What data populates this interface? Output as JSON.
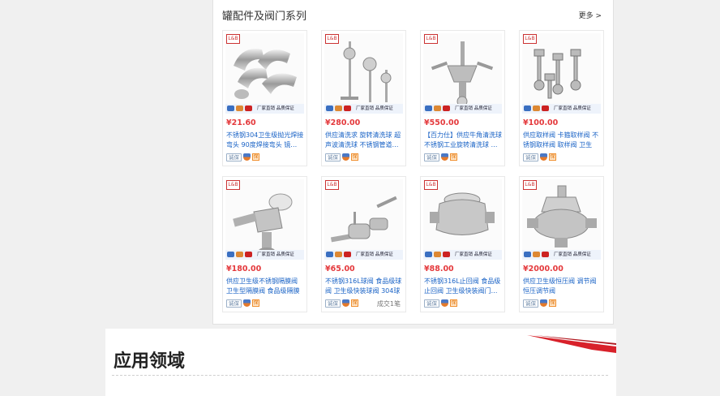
{
  "panel": {
    "title": "罐配件及阀门系列",
    "more": "更多 >"
  },
  "brand_badge": "L&B",
  "strip_text": "厂家直销 品质保证",
  "watermark": "润 百 精 品 专 业",
  "chip_label": "诚保",
  "products": [
    {
      "price": "¥21.60",
      "title": "不锈钢304卫生级抛光焊接弯头 90度焊接弯头 镜…",
      "sales": ""
    },
    {
      "price": "¥280.00",
      "title": "供应清洗求 旋转清洗球 超声波清洗球 不锈钢管道…",
      "sales": ""
    },
    {
      "price": "¥550.00",
      "title": "【百力仕】供应牛角清洗球 不锈钢工业旋转清洗球 …",
      "sales": ""
    },
    {
      "price": "¥100.00",
      "title": "供应取样阀 卡箍取样阀 不锈钢取样阀 取样阀 卫生级…",
      "sales": ""
    },
    {
      "price": "¥180.00",
      "title": "供应卫生级不锈钢隔膜阀 卫生型隔膜阀 食品级隔膜阀…",
      "sales": ""
    },
    {
      "price": "¥65.00",
      "title": "不锈钢316L球阀 食品级球阀 卫生级快装球阀 304球阀…",
      "sales": "成交1笔"
    },
    {
      "price": "¥88.00",
      "title": "不锈钢316L止回阀 食品级止回阀 卫生级快装阀门…",
      "sales": ""
    },
    {
      "price": "¥2000.00",
      "title": "供应卫生级恒压阀 调节阀 恒压调节阀",
      "sales": ""
    }
  ],
  "section": {
    "title": "应用领域"
  },
  "colors": {
    "price": "#e4393c",
    "link": "#1a63c6",
    "accent": "#d8212a"
  }
}
